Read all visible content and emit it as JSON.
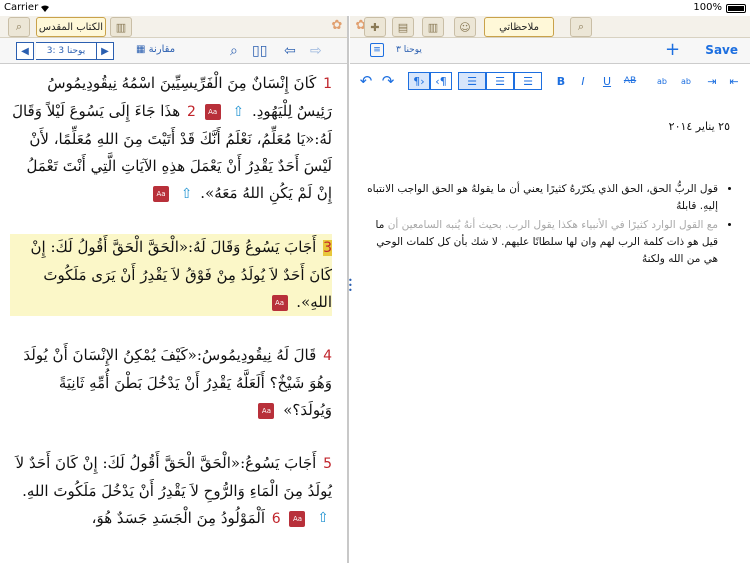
{
  "status": {
    "carrier": "Carrier",
    "time": "",
    "battery": "100%"
  },
  "left_tabs": {
    "bible_label": "الكتاب المقدس"
  },
  "right_tabs": {
    "notes_label": "ملاحظاتي"
  },
  "left_toolbar": {
    "reference": "يوحنا 3 :3",
    "compare": "مقارنة"
  },
  "right_toolbar": {
    "reference": "يوحنا ٣",
    "save": "Save"
  },
  "verses": [
    {
      "num": "1",
      "text": "كَانَ إِنْسَانٌ مِنَ الْفَرِّيسِيِّينَ اسْمُهُ نِيقُودِيمُوسُ رَئِيسٌ لِلْيَهُودِ."
    },
    {
      "num": "2",
      "text": "هذَا جَاءَ إِلَى يَسُوعَ لَيْلاً وَقَالَ لَهُ:«يَا مُعَلِّمُ، نَعْلَمُ أَنَّكَ قَدْ أَتَيْتَ مِنَ اللهِ مُعَلِّمًا، لأَنْ لَيْسَ أَحَدٌ يَقْدِرُ أَنْ يَعْمَلَ هذِهِ الآيَاتِ الَّتِي أَنْتَ تَعْمَلُ إِنْ لَمْ يَكُنِ اللهُ مَعَهُ»."
    },
    {
      "num": "3",
      "text": "أَجَابَ يَسُوعُ وَقَالَ لَهُ:«الْحَقَّ الْحَقَّ أَقُولُ لَكَ: إِنْ كَانَ أَحَدٌ لاَ يُولَدُ مِنْ فَوْقُ لاَ يَقْدِرُ أَنْ يَرَى مَلَكُوتَ اللهِ»."
    },
    {
      "num": "4",
      "text": "قَالَ لَهُ نِيقُودِيمُوسُ:«كَيْفَ يُمْكِنُ الإِنْسَانَ أَنْ يُولَدَ وَهُوَ شَيْخٌ؟ أَلَعَلَّهُ يَقْدِرُ أَنْ يَدْخُلَ بَطْنَ أُمِّهِ ثَانِيَةً وَيُولَدَ؟»"
    },
    {
      "num": "5",
      "text": "أَجَابَ يَسُوعُ:«الْحَقَّ الْحَقَّ أَقُولُ لَكَ: إِنْ كَانَ أَحَدٌ لاَ يُولَدُ مِنَ الْمَاءِ وَالرُّوحِ لاَ يَقْدِرُ أَنْ يَدْخُلَ مَلَكُوتَ اللهِ."
    },
    {
      "num": "6",
      "text": "اَلْمَوْلُودُ مِنَ الْجَسَدِ جَسَدٌ هُوَ،"
    }
  ],
  "badge": "Aa",
  "editor": {
    "date": "٢٥ يناير ٢٠١٤",
    "bullet1": "قول الربُّ الحق، الحق الذي يكرّرهُ كثيرًا يعني أن ما يقولهُ هو الحق الواجب الانتباه إليهِ. قابلهُ",
    "bullet2_grey": "مع القول الوارد كثيرًا في الأنبياء هكذا يقول الرب. بحيث أنهُ يُنبه السامعين أن",
    "bullet2_black": "ما قيل هو ذات كلمة الرب لهم وان لها سلطانًا عليهم. لا شك بأن كل كلمات الوحي هي من الله ولكنهُ"
  }
}
